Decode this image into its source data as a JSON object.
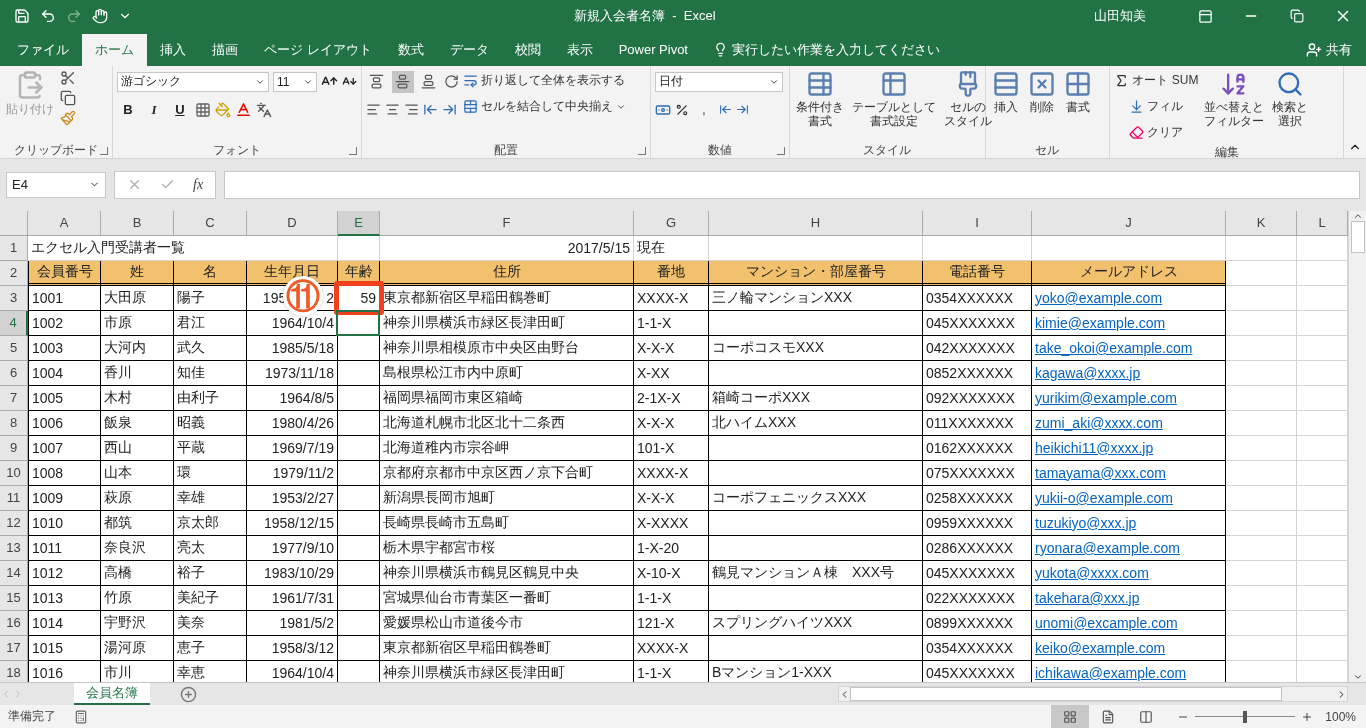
{
  "title_bar": {
    "document_title": "新規入会者名簿  -  Excel",
    "user": "山田知美"
  },
  "menu_tabs": [
    {
      "label": "ファイル",
      "selected": false
    },
    {
      "label": "ホーム",
      "selected": true
    },
    {
      "label": "挿入",
      "selected": false
    },
    {
      "label": "描画",
      "selected": false
    },
    {
      "label": "ページ レイアウト",
      "selected": false
    },
    {
      "label": "数式",
      "selected": false
    },
    {
      "label": "データ",
      "selected": false
    },
    {
      "label": "校閲",
      "selected": false
    },
    {
      "label": "表示",
      "selected": false
    },
    {
      "label": "Power Pivot",
      "selected": false
    }
  ],
  "tell_me": {
    "placeholder": "実行したい作業を入力してください"
  },
  "share": "共有",
  "ribbon": [
    {
      "kind": "clipboard",
      "label": "クリップボード",
      "paste": "貼り付け",
      "paste_disabled": true
    },
    {
      "kind": "font",
      "label": "フォント",
      "font_name": "游ゴシック",
      "font_size": "11",
      "bold": "B",
      "italic": "I",
      "underline": "U"
    },
    {
      "kind": "alignment",
      "label": "配置",
      "vertical": [
        {
          "selected": false
        },
        {
          "selected": true
        },
        {
          "selected": false
        }
      ],
      "wrap": "折り返して全体を表示する",
      "merge": "セルを結合して中央揃え"
    },
    {
      "kind": "number",
      "label": "数値",
      "format": "日付",
      "comma": ","
    },
    {
      "kind": "styles",
      "label": "スタイル",
      "buttons": [
        {
          "lines": [
            "条件付き",
            "書式"
          ]
        },
        {
          "lines": [
            "テーブルとして",
            "書式設定"
          ]
        },
        {
          "lines": [
            "セルの",
            "スタイル"
          ]
        }
      ]
    },
    {
      "kind": "cells",
      "label": "セル",
      "buttons": [
        "挿入",
        "削除",
        "書式"
      ]
    },
    {
      "kind": "editing",
      "label": "編集",
      "autosum": "オート SUM",
      "fill": "フィル",
      "clear": "クリア",
      "buttons": [
        {
          "lines": [
            "並べ替えと",
            "フィルター"
          ]
        },
        {
          "lines": [
            "検索と",
            "選択"
          ]
        }
      ]
    }
  ],
  "formula_bar": {
    "name_box": "E4",
    "function_button": "fx"
  },
  "sheet": {
    "columns": [
      {
        "label": "A",
        "selected": false
      },
      {
        "label": "B",
        "selected": false
      },
      {
        "label": "C",
        "selected": false
      },
      {
        "label": "D",
        "selected": false
      },
      {
        "label": "E",
        "selected": true
      },
      {
        "label": "F",
        "selected": false
      },
      {
        "label": "G",
        "selected": false
      },
      {
        "label": "H",
        "selected": false
      },
      {
        "label": "I",
        "selected": false
      },
      {
        "label": "J",
        "selected": false
      },
      {
        "label": "K",
        "selected": false
      },
      {
        "label": "L",
        "selected": false
      }
    ],
    "rows": [
      {
        "number": "1",
        "selected": false,
        "kind": "title",
        "cells": [
          "エクセル入門受講者一覧",
          null,
          null,
          null,
          null,
          "2017/5/15",
          "現在",
          null,
          null,
          null
        ]
      },
      {
        "number": "2",
        "selected": false,
        "kind": "header",
        "cells": [
          "会員番号",
          "姓",
          "名",
          "生年月日",
          "年齢",
          "住所",
          "番地",
          "マンション・部屋番号",
          "電話番号",
          "メールアドレス"
        ]
      },
      {
        "number": "3",
        "selected": false,
        "kind": "data",
        "cells": [
          "1001",
          "大田原",
          "陽子",
          {
            "start": "195",
            "end": "2"
          },
          "59",
          "東京都新宿区早稲田鶴巻町",
          "XXXX-X",
          "三ノ輪マンションXXX",
          "0354XXXXXX",
          "yoko@example.com"
        ]
      },
      {
        "number": "4",
        "selected": true,
        "kind": "data",
        "cells": [
          "1002",
          "市原",
          "君江",
          "1964/10/4",
          null,
          "神奈川県横浜市緑区長津田町",
          "1-1-X",
          null,
          "045XXXXXXX",
          "kimie@example.com"
        ]
      },
      {
        "number": "5",
        "selected": false,
        "kind": "data",
        "cells": [
          "1003",
          "大河内",
          "武久",
          "1985/5/18",
          null,
          "神奈川県相模原市中央区由野台",
          "X-X-X",
          "コーポコスモXXX",
          "042XXXXXXX",
          "take_okoi@example.com"
        ]
      },
      {
        "number": "6",
        "selected": false,
        "kind": "data",
        "cells": [
          "1004",
          "香川",
          "知佳",
          "1973/11/18",
          null,
          "島根県松江市内中原町",
          "X-XX",
          null,
          "0852XXXXXX",
          "kagawa@xxxx.jp"
        ]
      },
      {
        "number": "7",
        "selected": false,
        "kind": "data",
        "cells": [
          "1005",
          "木村",
          "由利子",
          "1964/8/5",
          null,
          "福岡県福岡市東区箱崎",
          "2-1X-X",
          "箱崎コーポXXX",
          "092XXXXXXX",
          "yurikim@example.com"
        ]
      },
      {
        "number": "8",
        "selected": false,
        "kind": "data",
        "cells": [
          "1006",
          "飯泉",
          "昭義",
          "1980/4/26",
          null,
          "北海道札幌市北区北十二条西",
          "X-X-X",
          "北ハイムXXX",
          "011XXXXXXX",
          "zumi_aki@xxxx.com"
        ]
      },
      {
        "number": "9",
        "selected": false,
        "kind": "data",
        "cells": [
          "1007",
          "西山",
          "平蔵",
          "1969/7/19",
          null,
          "北海道稚内市宗谷岬",
          "101-X",
          null,
          "0162XXXXXX",
          "heikichi11@xxxx.jp"
        ]
      },
      {
        "number": "10",
        "selected": false,
        "kind": "data",
        "cells": [
          "1008",
          "山本",
          "環",
          "1979/11/2",
          null,
          "京都府京都市中京区西ノ京下合町",
          "XXXX-X",
          null,
          "075XXXXXXX",
          "tamayama@xxx.com"
        ]
      },
      {
        "number": "11",
        "selected": false,
        "kind": "data",
        "cells": [
          "1009",
          "萩原",
          "幸雄",
          "1953/2/27",
          null,
          "新潟県長岡市旭町",
          "X-X-X",
          "コーポフェニックスXXX",
          "0258XXXXXX",
          "yukii-o@example.com"
        ]
      },
      {
        "number": "12",
        "selected": false,
        "kind": "data",
        "cells": [
          "1010",
          "都筑",
          "京太郎",
          "1958/12/15",
          null,
          "長崎県長崎市五島町",
          "X-XXXX",
          null,
          "0959XXXXXX",
          "tuzukiyo@xxx.jp"
        ]
      },
      {
        "number": "13",
        "selected": false,
        "kind": "data",
        "cells": [
          "1011",
          "奈良沢",
          "亮太",
          "1977/9/10",
          null,
          "栃木県宇都宮市桜",
          "1-X-20",
          null,
          "0286XXXXXX",
          "ryonara@example.com"
        ]
      },
      {
        "number": "14",
        "selected": false,
        "kind": "data",
        "cells": [
          "1012",
          "高橋",
          "裕子",
          "1983/10/29",
          null,
          "神奈川県横浜市鶴見区鶴見中央",
          "X-10-X",
          "鶴見マンションＡ棟　XXX号",
          "045XXXXXXX",
          "yukota@xxxx.com"
        ]
      },
      {
        "number": "15",
        "selected": false,
        "kind": "data",
        "cells": [
          "1013",
          "竹原",
          "美紀子",
          "1961/7/31",
          null,
          "宮城県仙台市青葉区一番町",
          "1-1-X",
          null,
          "022XXXXXXX",
          "takehara@xxx.jp"
        ]
      },
      {
        "number": "16",
        "selected": false,
        "kind": "data",
        "cells": [
          "1014",
          "宇野沢",
          "美奈",
          "1981/5/2",
          null,
          "愛媛県松山市道後今市",
          "121-X",
          "スプリングハイツXXX",
          "0899XXXXXX",
          "unomi@excample.com"
        ]
      },
      {
        "number": "17",
        "selected": false,
        "kind": "data",
        "cells": [
          "1015",
          "湯河原",
          "恵子",
          "1958/3/12",
          null,
          "東京都新宿区早稲田鶴巻町",
          "XXXX-X",
          null,
          "0354XXXXXX",
          "keiko@example.com"
        ]
      },
      {
        "number": "18",
        "selected": false,
        "kind": "data",
        "cells": [
          "1016",
          "市川",
          "幸恵",
          "1964/10/4",
          null,
          "神奈川県横浜市緑区長津田町",
          "1-1-X",
          "Bマンション1-XXX",
          "045XXXXXXX",
          "ichikawa@example.com"
        ]
      }
    ],
    "callout": {
      "number": "⑪"
    }
  },
  "sheet_tabs": [
    {
      "label": "会員名簿",
      "selected": true
    }
  ],
  "status_bar": {
    "status": "準備完了",
    "views": [
      {
        "kind": "normal",
        "selected": true
      },
      {
        "kind": "page_layout",
        "selected": false
      },
      {
        "kind": "page_break",
        "selected": false
      }
    ],
    "zoom": {
      "level": 0.5,
      "reading": "100%"
    }
  }
}
